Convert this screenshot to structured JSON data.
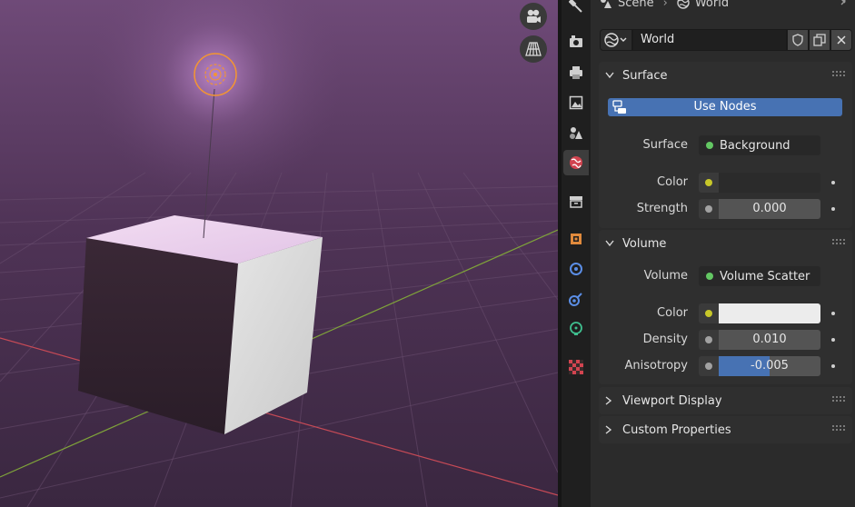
{
  "header": {
    "scene_label": "Scene",
    "world_label": "World"
  },
  "datablock": {
    "name": "World"
  },
  "surface": {
    "title": "Surface",
    "use_nodes_label": "Use Nodes",
    "surface_label": "Surface",
    "surface_value": "Background",
    "color_label": "Color",
    "color_value": "#2b2b2b",
    "strength_label": "Strength",
    "strength_value": "0.000"
  },
  "volume": {
    "title": "Volume",
    "volume_label": "Volume",
    "volume_value": "Volume Scatter",
    "color_label": "Color",
    "color_value": "#ececec",
    "density_label": "Density",
    "density_value": "0.010",
    "anisotropy_label": "Anisotropy",
    "anisotropy_value": "-0.005",
    "anisotropy_fraction": 0.4975
  },
  "collapsed_panels": [
    {
      "title": "Viewport Display"
    },
    {
      "title": "Custom Properties"
    }
  ],
  "colors": {
    "accent": "#4772b3",
    "shader_socket": "#63c763",
    "color_socket": "#c7c729",
    "value_socket": "#a1a1a1",
    "light_selected": "#f29533",
    "axis_x": "#d24450",
    "axis_y": "#7fa33a"
  },
  "tabs": [
    {
      "icon": "tool-icon"
    },
    {
      "icon": "render-icon"
    },
    {
      "icon": "output-icon"
    },
    {
      "icon": "view-layer-icon"
    },
    {
      "icon": "scene-icon"
    },
    {
      "icon": "world-icon",
      "active": true
    },
    {
      "icon": "collection-icon"
    },
    {
      "icon": "object-icon"
    },
    {
      "icon": "modifier-icon"
    },
    {
      "icon": "physics-icon"
    },
    {
      "icon": "object-data-light-icon"
    },
    {
      "icon": "texture-icon"
    }
  ]
}
